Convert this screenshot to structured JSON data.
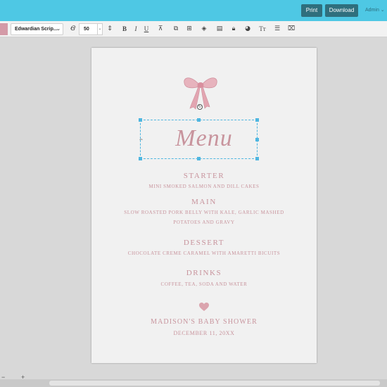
{
  "topbar": {
    "print_label": "Print",
    "download_label": "Download",
    "account_label": "Admin"
  },
  "toolbar": {
    "swatch_color": "#d49aa7",
    "font_family_value": "Edwardian Scrip...",
    "font_size_value": "50",
    "icons": [
      "swatch",
      "text-color-icon",
      "font-select-dropdown",
      "text-style-icon",
      "font-size-input",
      "line-height-icon",
      "bold-icon",
      "italic-icon",
      "underline-icon",
      "strikethrough-icon",
      "duplicate-icon",
      "layers-icon",
      "lock-icon",
      "color-fill-icon",
      "text-transform-icon",
      "list-icon",
      "clear-format-icon"
    ]
  },
  "document": {
    "title": "Menu",
    "sections": [
      {
        "heading": "STARTER",
        "items": [
          "MINI SMOKED SALMON AND DILL CAKES"
        ]
      },
      {
        "heading": "MAIN",
        "items": [
          "SLOW ROASTED PORK BELLY WITH KALE, GARLIC MASHED",
          "POTATOES AND GRAVY"
        ]
      },
      {
        "heading": "DESSERT",
        "items": [
          "CHOCOLATE CREME CARAMEL WITH AMARETTI BICUITS"
        ]
      },
      {
        "heading": "DRINKS",
        "items": [
          "COFFEE, TEA, SODA AND WATER"
        ]
      }
    ],
    "event_name": "MADISON'S BABY SHOWER",
    "event_date": "DECEMBER 11, 20XX"
  },
  "colors": {
    "accent": "#4ec8e4",
    "button": "#2f6f7d",
    "text_pink": "#c8949d",
    "selection": "#4fb6e0"
  }
}
